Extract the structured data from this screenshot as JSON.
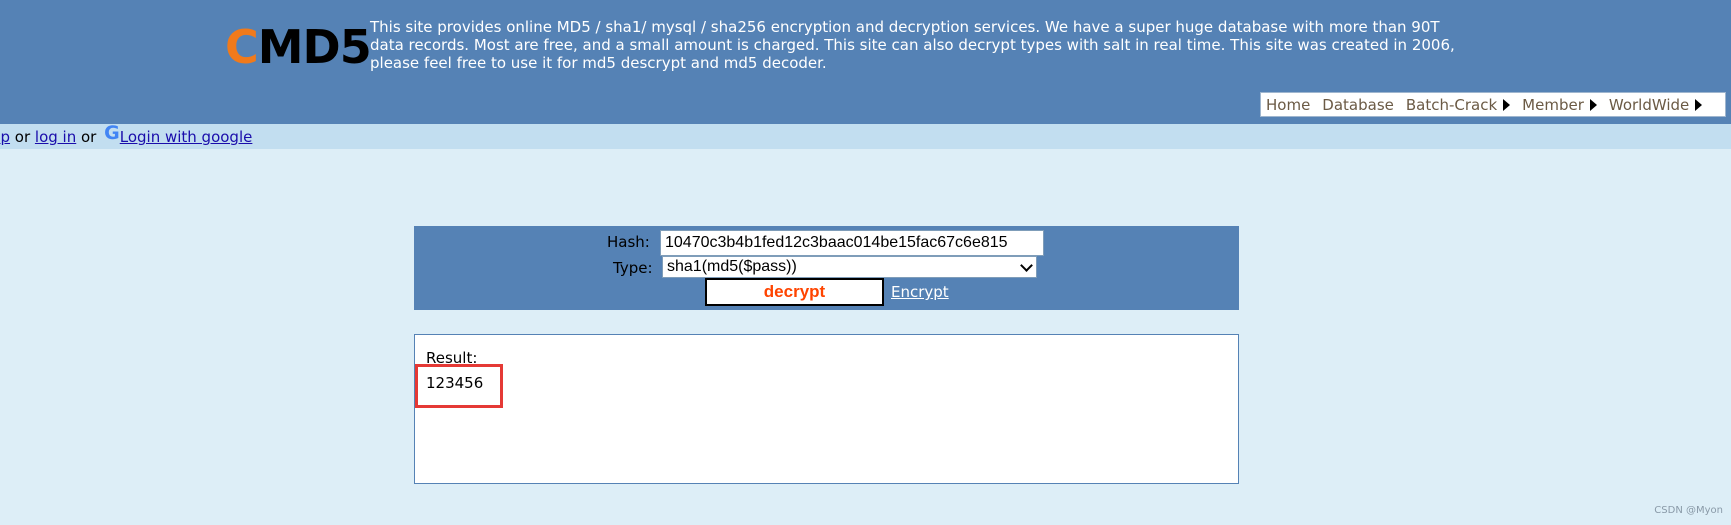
{
  "header": {
    "logo_c": "C",
    "logo_rest": "MD5",
    "intro": "This site provides online MD5 / sha1/ mysql / sha256 encryption and decryption services. We have a super huge database with more than 90T data records. Most are free, and a small amount is charged. This site can also decrypt types with salt in real time. This site was created in 2006, please feel free to use it for md5 descrypt and md5 decoder.",
    "nav": [
      "Home",
      "Database",
      "Batch-Crack",
      "Member",
      "WorldWide"
    ]
  },
  "loginbar": {
    "signup_fragment": "up",
    "or1": " or ",
    "login": "log in",
    "or2": " or ",
    "google_icon": "G",
    "google": "Login with google"
  },
  "form": {
    "hash_label": "Hash:",
    "hash_value": "10470c3b4b1fed12c3baac014be15fac67c6e815",
    "type_label": "Type:",
    "type_value": "sha1(md5($pass))",
    "decrypt_label": "decrypt",
    "encrypt_link": "Encrypt"
  },
  "result": {
    "label": "Result:",
    "value": "123456"
  },
  "watermark": "CSDN @Myon⁠",
  "colors": {
    "header_bg": "#5582b5",
    "page_bg": "#ddeef7",
    "loginbar_bg": "#c2def0",
    "decrypt_text": "#ff4400",
    "logo_accent": "#f07a1b",
    "highlight": "#e53935"
  }
}
